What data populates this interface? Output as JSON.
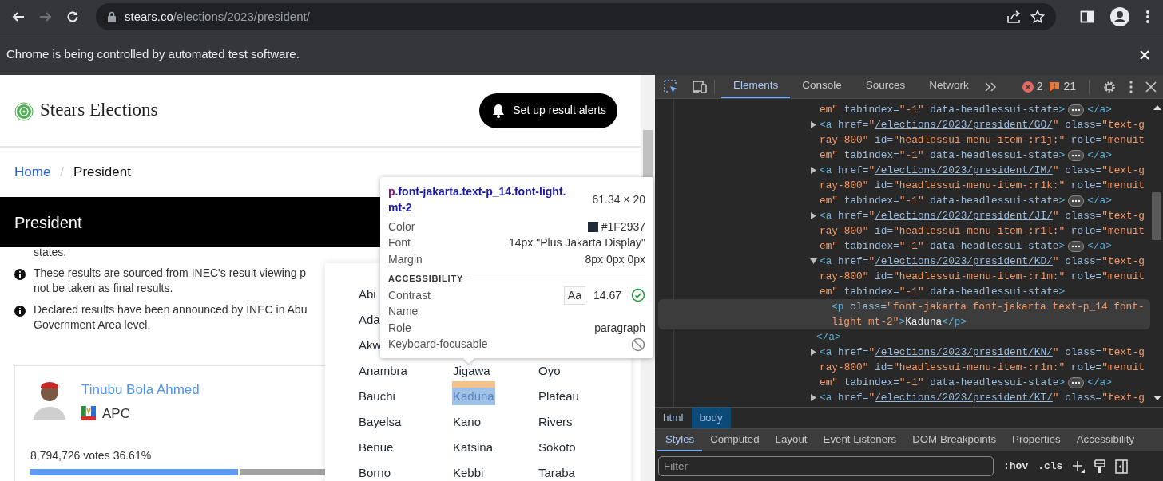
{
  "browser": {
    "nav_buttons": [
      {
        "kind": "back",
        "disabled": false
      },
      {
        "kind": "forward",
        "disabled": true
      },
      {
        "kind": "reload",
        "disabled": false
      }
    ],
    "url_host": "stears.co",
    "url_path": "/elections/2023/president/",
    "infobar": "Chrome is being controlled by automated test software."
  },
  "page": {
    "logo": "Stears Elections",
    "alert_button": "Set up result alerts",
    "breadcrumb": [
      {
        "label": "Home",
        "kind": "link"
      },
      {
        "label": "/",
        "kind": "separator"
      },
      {
        "label": "President",
        "kind": "current"
      }
    ],
    "banner": "President",
    "notes": [
      {
        "kind": "continuation",
        "lines": [
          "states."
        ]
      },
      {
        "kind": "info",
        "lines": [
          "These results are sourced from INEC's result viewing p",
          "not be taken as final results."
        ]
      },
      {
        "kind": "info",
        "lines": [
          "Declared results have been announced by INEC in Abu",
          "Government Area level."
        ]
      }
    ],
    "candidate": {
      "name": "Tinubu Bola Ahmed",
      "party": "APC",
      "votes": "8,794,726 votes",
      "share": "36.61%",
      "level": 0.3661
    },
    "state_menu": {
      "rows": [
        {
          "cells": [
            {
              "label": "Abi",
              "selected": false
            }
          ]
        },
        {
          "cells": [
            {
              "label": "Ada",
              "selected": false
            }
          ]
        },
        {
          "cells": [
            {
              "label": "Akw",
              "selected": false
            }
          ]
        },
        {
          "cells": [
            {
              "label": "Anambra",
              "selected": false
            },
            {
              "label": "Jigawa",
              "selected": false
            },
            {
              "label": "Oyo",
              "selected": false
            }
          ]
        },
        {
          "cells": [
            {
              "label": "Bauchi",
              "selected": false
            },
            {
              "label": "Kaduna",
              "selected": true
            },
            {
              "label": "Plateau",
              "selected": false
            }
          ]
        },
        {
          "cells": [
            {
              "label": "Bayelsa",
              "selected": false
            },
            {
              "label": "Kano",
              "selected": false
            },
            {
              "label": "Rivers",
              "selected": false
            }
          ]
        },
        {
          "cells": [
            {
              "label": "Benue",
              "selected": false
            },
            {
              "label": "Katsina",
              "selected": false
            },
            {
              "label": "Sokoto",
              "selected": false
            }
          ]
        },
        {
          "cells": [
            {
              "label": "Borno",
              "selected": false
            },
            {
              "label": "Kebbi",
              "selected": false
            },
            {
              "label": "Taraba",
              "selected": false
            }
          ]
        }
      ]
    },
    "inspect_tooltip": {
      "selector_tag": "p",
      "selector_classes": ".font-jakarta.text-p_14.font-light.mt-2",
      "size": "61.34 × 20",
      "properties": [
        {
          "label": "Color",
          "kind": "color",
          "value": "#1F2937"
        },
        {
          "label": "Font",
          "kind": "text",
          "value": "14px \"Plus Jakarta Display\""
        },
        {
          "label": "Margin",
          "kind": "text",
          "value": "8px 0px 0px"
        }
      ],
      "section": "ACCESSIBILITY",
      "accessibility": [
        {
          "label": "Contrast",
          "kind": "contrast",
          "sample": "Aa",
          "value": "14.67",
          "pass": true
        },
        {
          "label": "Name",
          "kind": "text"
        },
        {
          "label": "Role",
          "kind": "text",
          "value": "paragraph"
        },
        {
          "label": "Keyboard-focusable",
          "kind": "flag",
          "on": false
        }
      ]
    }
  },
  "devtools": {
    "tools": [
      {
        "kind": "inspect",
        "on": true
      },
      {
        "kind": "device",
        "on": false
      }
    ],
    "tabs": [
      {
        "label": "Elements",
        "selected": true
      },
      {
        "label": "Console",
        "selected": false
      },
      {
        "label": "Sources",
        "selected": false
      },
      {
        "label": "Network",
        "selected": false
      }
    ],
    "errors": "2",
    "warnings": "21",
    "dom_nodes": [
      {
        "selected": false,
        "lines": [
          [
            {
              "kind": "value",
              "text": "em\""
            },
            {
              "kind": "attr",
              "text": " tabindex="
            },
            {
              "kind": "value",
              "text": "\"-1\""
            },
            {
              "kind": "attr",
              "text": " data-headlessui-state"
            },
            {
              "kind": "tag",
              "text": ">"
            },
            {
              "kind": "ellipsis"
            },
            {
              "kind": "tag",
              "text": "</a>"
            }
          ]
        ]
      },
      {
        "expanded": false,
        "selected": false,
        "lines": [
          [
            {
              "kind": "tag",
              "text": "<a"
            },
            {
              "kind": "attr",
              "text": " href="
            },
            {
              "kind": "value",
              "text": "\""
            },
            {
              "kind": "link",
              "text": "/elections/2023/president/GO/"
            },
            {
              "kind": "value",
              "text": "\""
            },
            {
              "kind": "attr",
              "text": " class="
            },
            {
              "kind": "value",
              "text": "\"text-g"
            }
          ],
          [
            {
              "kind": "value",
              "text": "ray-800\""
            },
            {
              "kind": "attr",
              "text": " id="
            },
            {
              "kind": "value",
              "text": "\"headlessui-menu-item-:r1j:\""
            },
            {
              "kind": "attr",
              "text": " role="
            },
            {
              "kind": "value",
              "text": "\"menuit"
            }
          ],
          [
            {
              "kind": "value",
              "text": "em\""
            },
            {
              "kind": "attr",
              "text": " tabindex="
            },
            {
              "kind": "value",
              "text": "\"-1\""
            },
            {
              "kind": "attr",
              "text": " data-headlessui-state"
            },
            {
              "kind": "tag",
              "text": ">"
            },
            {
              "kind": "ellipsis"
            },
            {
              "kind": "tag",
              "text": "</a>"
            }
          ]
        ]
      },
      {
        "expanded": false,
        "selected": false,
        "lines": [
          [
            {
              "kind": "tag",
              "text": "<a"
            },
            {
              "kind": "attr",
              "text": " href="
            },
            {
              "kind": "value",
              "text": "\""
            },
            {
              "kind": "link",
              "text": "/elections/2023/president/IM/"
            },
            {
              "kind": "value",
              "text": "\""
            },
            {
              "kind": "attr",
              "text": " class="
            },
            {
              "kind": "value",
              "text": "\"text-g"
            }
          ],
          [
            {
              "kind": "value",
              "text": "ray-800\""
            },
            {
              "kind": "attr",
              "text": " id="
            },
            {
              "kind": "value",
              "text": "\"headlessui-menu-item-:r1k:\""
            },
            {
              "kind": "attr",
              "text": " role="
            },
            {
              "kind": "value",
              "text": "\"menuit"
            }
          ],
          [
            {
              "kind": "value",
              "text": "em\""
            },
            {
              "kind": "attr",
              "text": " tabindex="
            },
            {
              "kind": "value",
              "text": "\"-1\""
            },
            {
              "kind": "attr",
              "text": " data-headlessui-state"
            },
            {
              "kind": "tag",
              "text": ">"
            },
            {
              "kind": "ellipsis"
            },
            {
              "kind": "tag",
              "text": "</a>"
            }
          ]
        ]
      },
      {
        "expanded": false,
        "selected": false,
        "lines": [
          [
            {
              "kind": "tag",
              "text": "<a"
            },
            {
              "kind": "attr",
              "text": " href="
            },
            {
              "kind": "value",
              "text": "\""
            },
            {
              "kind": "link",
              "text": "/elections/2023/president/JI/"
            },
            {
              "kind": "value",
              "text": "\""
            },
            {
              "kind": "attr",
              "text": " class="
            },
            {
              "kind": "value",
              "text": "\"text-g"
            }
          ],
          [
            {
              "kind": "value",
              "text": "ray-800\""
            },
            {
              "kind": "attr",
              "text": " id="
            },
            {
              "kind": "value",
              "text": "\"headlessui-menu-item-:r1l:\""
            },
            {
              "kind": "attr",
              "text": " role="
            },
            {
              "kind": "value",
              "text": "\"menuit"
            }
          ],
          [
            {
              "kind": "value",
              "text": "em\""
            },
            {
              "kind": "attr",
              "text": " tabindex="
            },
            {
              "kind": "value",
              "text": "\"-1\""
            },
            {
              "kind": "attr",
              "text": " data-headlessui-state"
            },
            {
              "kind": "tag",
              "text": ">"
            },
            {
              "kind": "ellipsis"
            },
            {
              "kind": "tag",
              "text": "</a>"
            }
          ]
        ]
      },
      {
        "expanded": true,
        "selected": false,
        "lines": [
          [
            {
              "kind": "tag",
              "text": "<a"
            },
            {
              "kind": "attr",
              "text": " href="
            },
            {
              "kind": "value",
              "text": "\""
            },
            {
              "kind": "link",
              "text": "/elections/2023/president/KD/"
            },
            {
              "kind": "value",
              "text": "\""
            },
            {
              "kind": "attr",
              "text": " class="
            },
            {
              "kind": "value",
              "text": "\"text-g"
            }
          ],
          [
            {
              "kind": "value",
              "text": "ray-800\""
            },
            {
              "kind": "attr",
              "text": " id="
            },
            {
              "kind": "value",
              "text": "\"headlessui-menu-item-:r1m:\""
            },
            {
              "kind": "attr",
              "text": " role="
            },
            {
              "kind": "value",
              "text": "\"menuit"
            }
          ],
          [
            {
              "kind": "value",
              "text": "em\""
            },
            {
              "kind": "attr",
              "text": " tabindex="
            },
            {
              "kind": "value",
              "text": "\"-1\""
            },
            {
              "kind": "attr",
              "text": " data-headlessui-state"
            },
            {
              "kind": "tag",
              "text": ">"
            }
          ]
        ],
        "children": [
          {
            "selected": true,
            "lines": [
              [
                {
                  "kind": "tag",
                  "text": "<p"
                },
                {
                  "kind": "attr",
                  "text": " class="
                },
                {
                  "kind": "value",
                  "text": "\"font-jakarta font-jakarta text-p_14 font-"
                }
              ],
              [
                {
                  "kind": "value",
                  "text": "light mt-2\""
                },
                {
                  "kind": "tag",
                  "text": ">"
                },
                {
                  "kind": "text",
                  "text": "Kaduna"
                },
                {
                  "kind": "tag",
                  "text": "</p>"
                }
              ]
            ]
          }
        ],
        "closing": [
          {
            "kind": "tag",
            "text": "</a>"
          }
        ]
      },
      {
        "expanded": false,
        "selected": false,
        "lines": [
          [
            {
              "kind": "tag",
              "text": "<a"
            },
            {
              "kind": "attr",
              "text": " href="
            },
            {
              "kind": "value",
              "text": "\""
            },
            {
              "kind": "link",
              "text": "/elections/2023/president/KN/"
            },
            {
              "kind": "value",
              "text": "\""
            },
            {
              "kind": "attr",
              "text": " class="
            },
            {
              "kind": "value",
              "text": "\"text-g"
            }
          ],
          [
            {
              "kind": "value",
              "text": "ray-800\""
            },
            {
              "kind": "attr",
              "text": " id="
            },
            {
              "kind": "value",
              "text": "\"headlessui-menu-item-:r1n:\""
            },
            {
              "kind": "attr",
              "text": " role="
            },
            {
              "kind": "value",
              "text": "\"menuit"
            }
          ],
          [
            {
              "kind": "value",
              "text": "em\""
            },
            {
              "kind": "attr",
              "text": " tabindex="
            },
            {
              "kind": "value",
              "text": "\"-1\""
            },
            {
              "kind": "attr",
              "text": " data-headlessui-state"
            },
            {
              "kind": "tag",
              "text": ">"
            },
            {
              "kind": "ellipsis"
            },
            {
              "kind": "tag",
              "text": "</a>"
            }
          ]
        ]
      },
      {
        "expanded": false,
        "selected": false,
        "lines": [
          [
            {
              "kind": "tag",
              "text": "<a"
            },
            {
              "kind": "attr",
              "text": " href="
            },
            {
              "kind": "value",
              "text": "\""
            },
            {
              "kind": "link",
              "text": "/elections/2023/president/KT/"
            },
            {
              "kind": "value",
              "text": "\""
            },
            {
              "kind": "attr",
              "text": " class="
            },
            {
              "kind": "value",
              "text": "\"text-g"
            }
          ]
        ]
      }
    ],
    "crumbs": [
      {
        "label": "html",
        "selected": false
      },
      {
        "label": "body",
        "selected": true
      }
    ],
    "pane_tabs": [
      {
        "label": "Styles",
        "selected": true
      },
      {
        "label": "Computed",
        "selected": false
      },
      {
        "label": "Layout",
        "selected": false
      },
      {
        "label": "Event Listeners",
        "selected": false
      },
      {
        "label": "DOM Breakpoints",
        "selected": false
      },
      {
        "label": "Properties",
        "selected": false
      },
      {
        "label": "Accessibility",
        "selected": false
      }
    ],
    "filter": {
      "placeholder": "Filter"
    },
    "filter_buttons": [
      ":hov",
      ".cls"
    ]
  }
}
